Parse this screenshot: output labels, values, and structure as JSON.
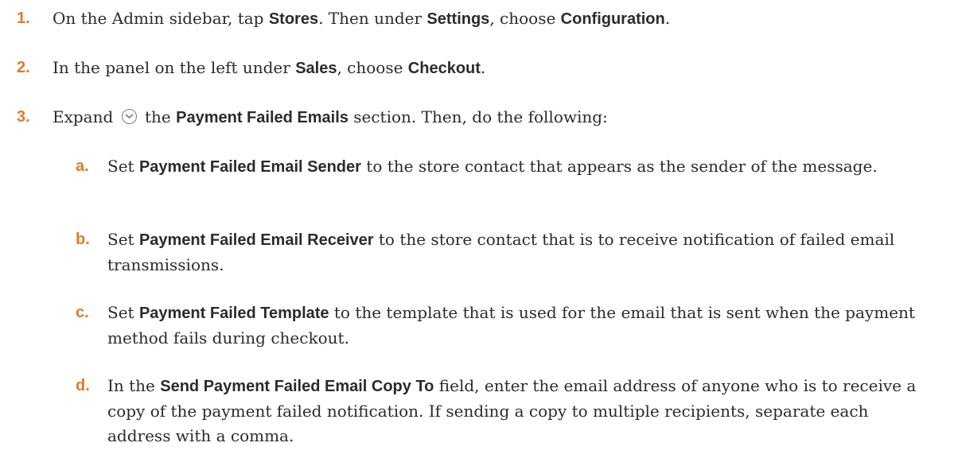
{
  "steps": [
    {
      "number": "1.",
      "parts": [
        "On the Admin sidebar, tap ",
        "Stores",
        ". Then under ",
        "Settings",
        ", choose ",
        "Configuration",
        "."
      ]
    },
    {
      "number": "2.",
      "parts": [
        "In the panel on the left under ",
        "Sales",
        ", choose ",
        "Checkout",
        "."
      ]
    },
    {
      "number": "3.",
      "parts": [
        "Expand ",
        " the ",
        "Payment Failed Emails",
        " section. Then, do the following:"
      ],
      "icon": "expand-chevron-circle-icon"
    }
  ],
  "substeps": [
    {
      "letter": "a.",
      "parts": [
        "Set ",
        "Payment Failed Email Sender",
        " to the store contact that appears as the sender of the message."
      ]
    },
    {
      "letter": "b.",
      "parts": [
        "Set ",
        "Payment Failed Email Receiver",
        " to the store contact that is to receive notification of failed email transmissions."
      ]
    },
    {
      "letter": "c.",
      "parts": [
        "Set ",
        "Payment Failed Template",
        " to the template that is used for the email that is sent when the payment method fails during checkout."
      ]
    },
    {
      "letter": "d.",
      "parts": [
        "In the ",
        "Send Payment Failed Email Copy To",
        " field, enter the email address of anyone who is to receive a copy of the payment failed notification. If sending a copy to multiple recipients, separate each address with a comma."
      ]
    }
  ],
  "colors": {
    "step_number": "#e07a28",
    "text": "#2b2b2b",
    "icon": "#7a7a7a"
  }
}
